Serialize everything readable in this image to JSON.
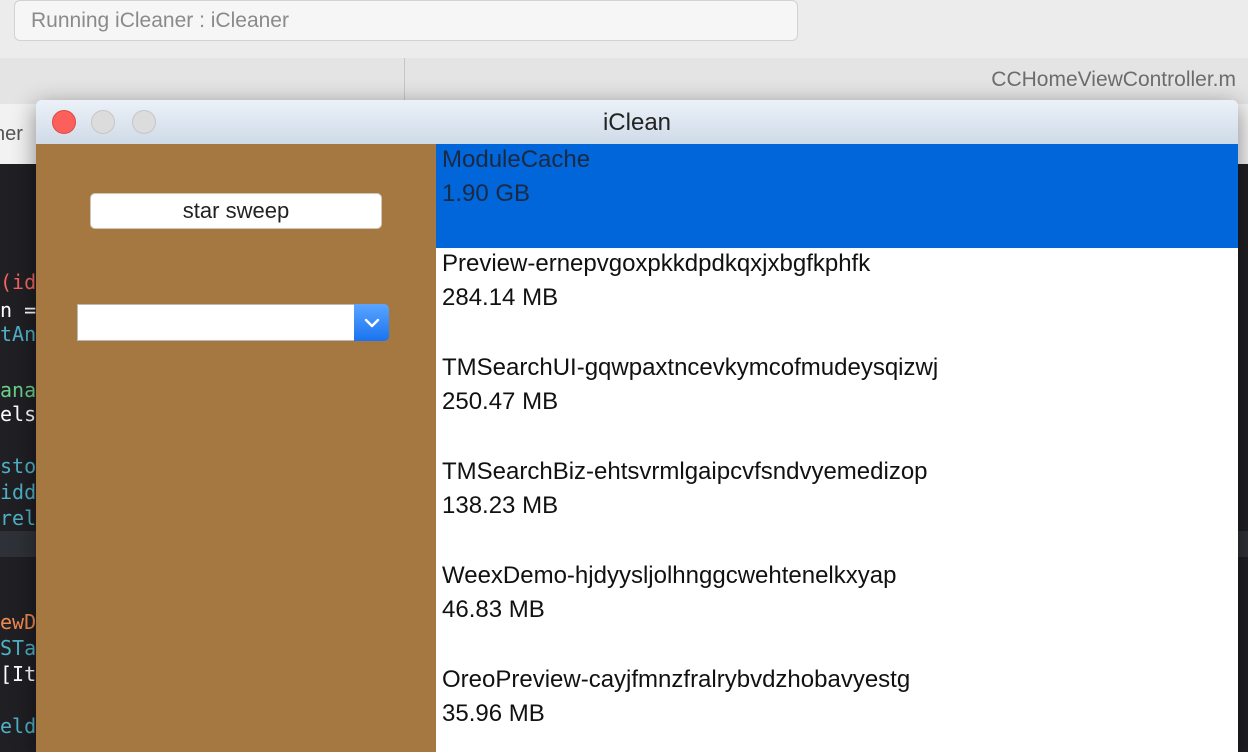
{
  "background": {
    "status_text": "Running iCleaner : iCleaner",
    "tab_right_label": "CCHomeViewController.m",
    "jump_left_text": "ner",
    "code_fragments": [
      {
        "text": "(id",
        "color": "#f0665f"
      },
      {
        "text": "n =",
        "color": "#ffffff"
      },
      {
        "text": "tAn",
        "color": "#4fb0c6"
      },
      {
        "text": "ana",
        "color": "#6bd18a"
      },
      {
        "text": "els",
        "color": "#ffffff"
      },
      {
        "text": "sto",
        "color": "#4fb0c6"
      },
      {
        "text": "idd",
        "color": "#4fb0c6"
      },
      {
        "text": "rel",
        "color": "#4fb0c6"
      },
      {
        "text": "ewD",
        "color": "#ef8a4f"
      },
      {
        "text": "STa",
        "color": "#4fb0c6"
      },
      {
        "text": "[Ita",
        "color": "#ffffff"
      },
      {
        "text": "eld",
        "color": "#4fb0c6"
      }
    ]
  },
  "window": {
    "title": "iClean",
    "sidebar": {
      "sweep_button_label": "star sweep",
      "combo_value": ""
    },
    "list": {
      "items": [
        {
          "name": "ModuleCache",
          "size": "1.90 GB",
          "selected": true
        },
        {
          "name": "Preview-ernepvgoxpkkdpdkqxjxbgfkphfk",
          "size": "284.14 MB",
          "selected": false
        },
        {
          "name": "TMSearchUI-gqwpaxtncevkymcofmudeysqizwj",
          "size": "250.47 MB",
          "selected": false
        },
        {
          "name": "TMSearchBiz-ehtsvrmlgaipcvfsndvyemedizop",
          "size": "138.23 MB",
          "selected": false
        },
        {
          "name": "WeexDemo-hjdyysljolhnggcwehtenelkxyap",
          "size": "46.83 MB",
          "selected": false
        },
        {
          "name": "OreoPreview-cayjfmnzfralrybvdzhobavyestg",
          "size": "35.96 MB",
          "selected": false
        }
      ]
    }
  },
  "colors": {
    "sidebar_bg": "#a67841",
    "selection": "#0066d9",
    "close_button": "#fc605b"
  }
}
